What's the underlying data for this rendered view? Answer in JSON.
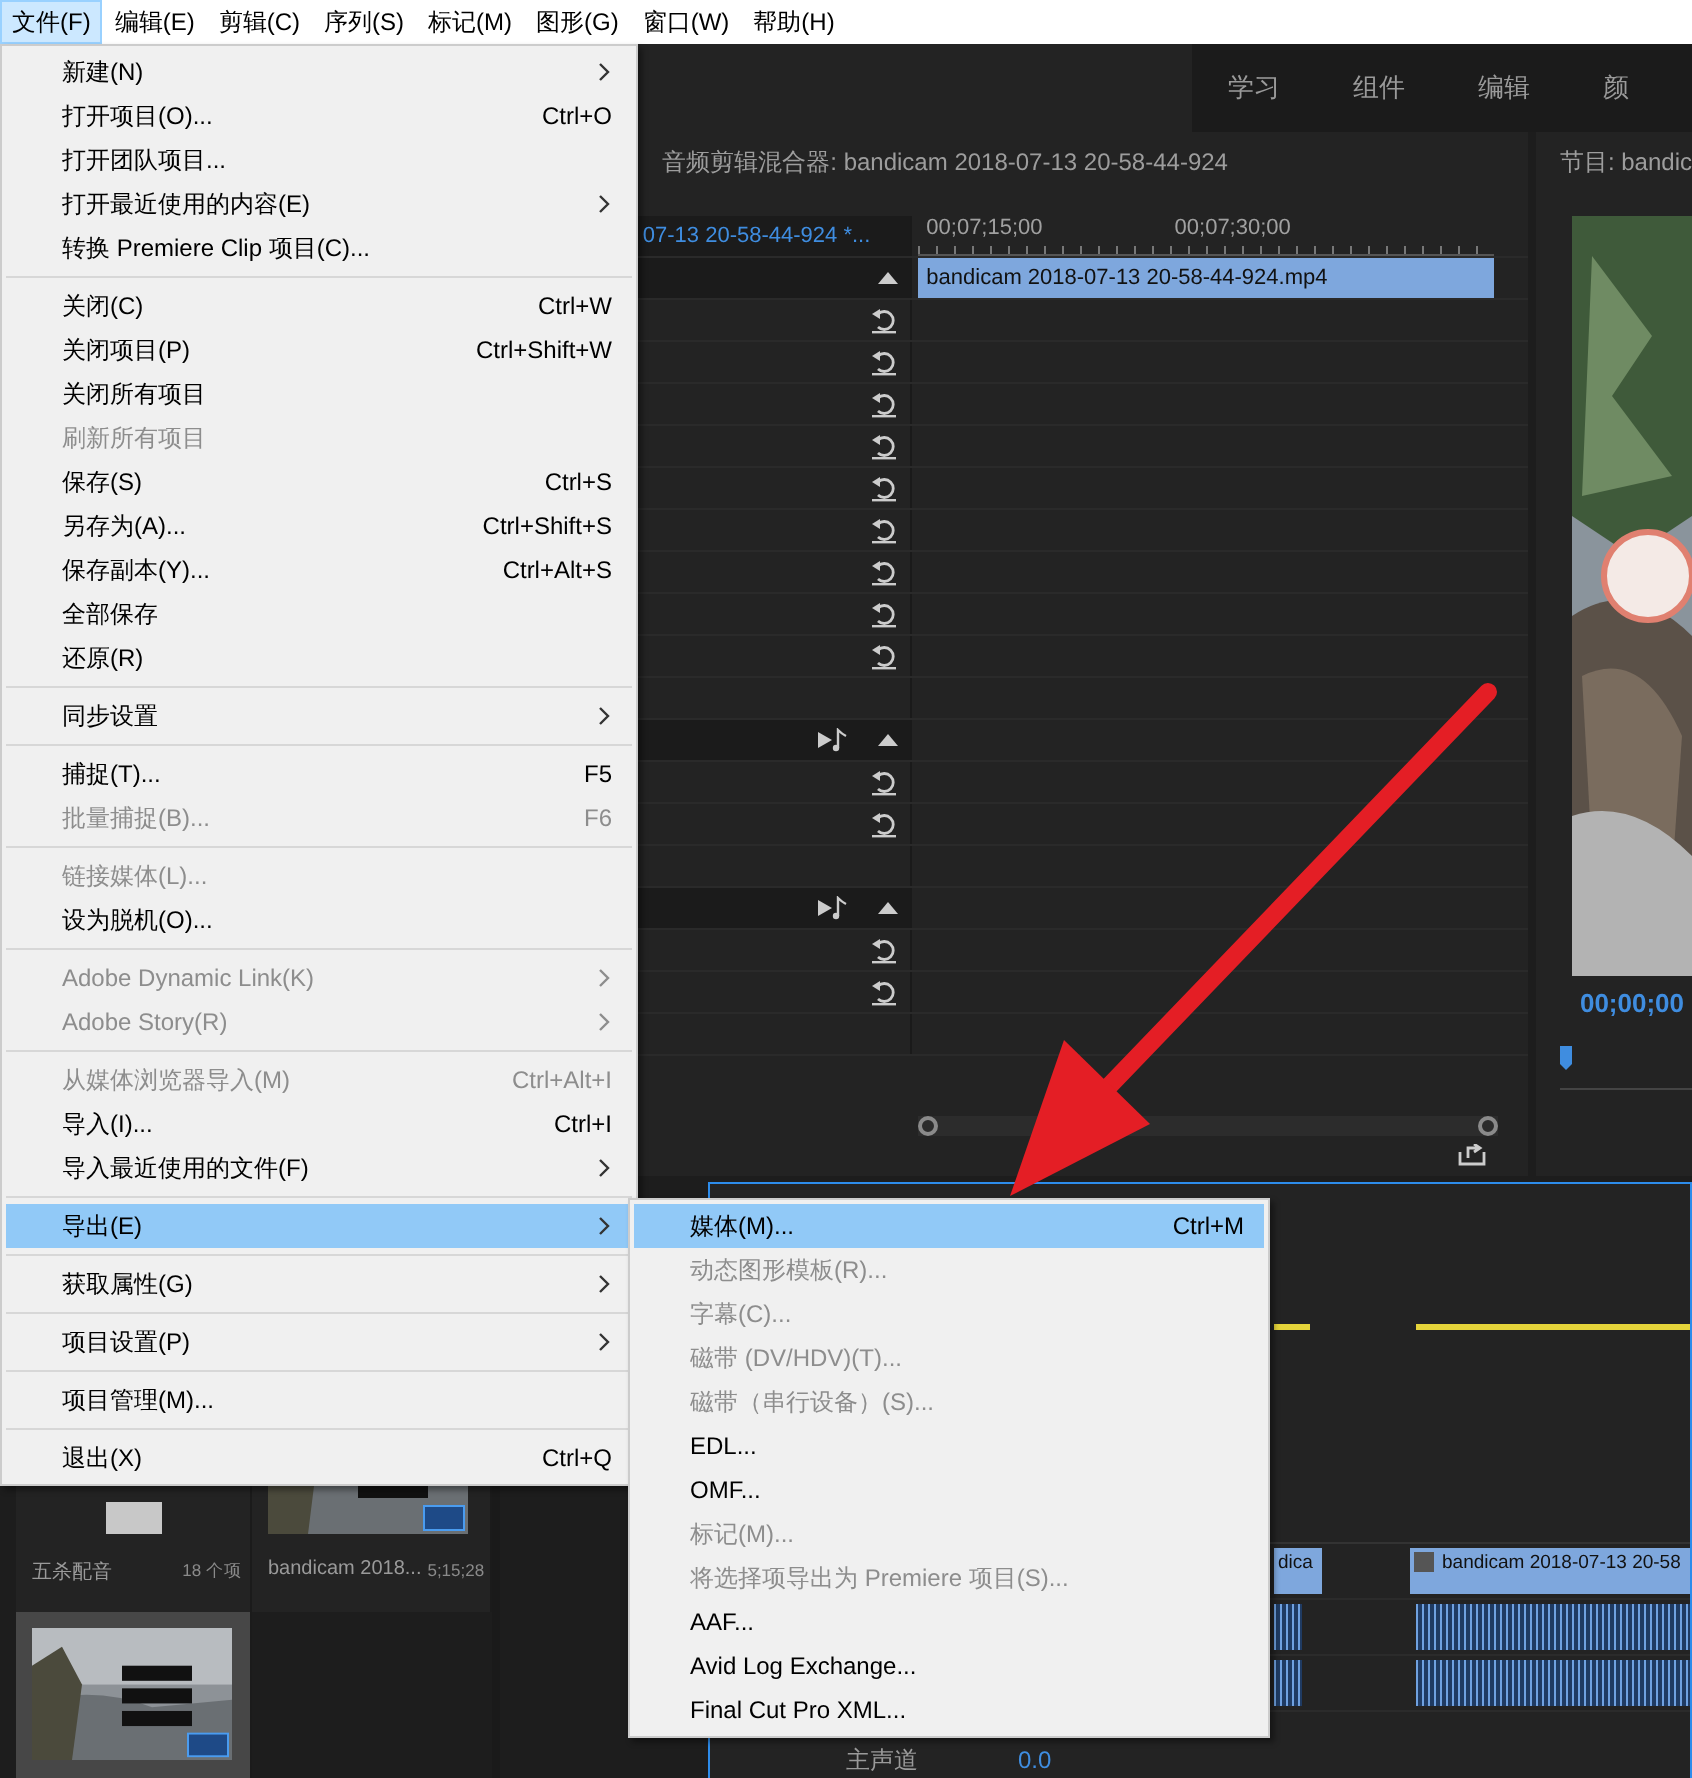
{
  "menubar": [
    {
      "label": "文件(F)",
      "selected": true
    },
    {
      "label": "编辑(E)",
      "selected": false
    },
    {
      "label": "剪辑(C)",
      "selected": false
    },
    {
      "label": "序列(S)",
      "selected": false
    },
    {
      "label": "标记(M)",
      "selected": false
    },
    {
      "label": "图形(G)",
      "selected": false
    },
    {
      "label": "窗口(W)",
      "selected": false
    },
    {
      "label": "帮助(H)",
      "selected": false
    }
  ],
  "workspaces": [
    {
      "label": "学习"
    },
    {
      "label": "组件"
    },
    {
      "label": "编辑"
    },
    {
      "label": "颜"
    }
  ],
  "audio_mixer": {
    "title": "音频剪辑混合器: bandicam 2018-07-13 20-58-44-924",
    "sequence_tab": "07-13 20-58-44-924 *...",
    "ruler": [
      "00;07;15;00",
      "00;07;30;00"
    ],
    "clip": "bandicam 2018-07-13 20-58-44-924.mp4",
    "tracks": [
      {
        "kind": "collapse"
      },
      {
        "kind": "reset"
      },
      {
        "kind": "reset"
      },
      {
        "kind": "reset"
      },
      {
        "kind": "reset"
      },
      {
        "kind": "reset"
      },
      {
        "kind": "reset"
      },
      {
        "kind": "reset"
      },
      {
        "kind": "reset"
      },
      {
        "kind": "reset"
      },
      {
        "kind": "empty"
      },
      {
        "kind": "audio"
      },
      {
        "kind": "reset"
      },
      {
        "kind": "reset"
      },
      {
        "kind": "empty"
      },
      {
        "kind": "audio"
      },
      {
        "kind": "reset"
      },
      {
        "kind": "reset"
      },
      {
        "kind": "empty"
      }
    ]
  },
  "program_monitor": {
    "title": "节目: bandic",
    "timecode": "00;00;00"
  },
  "project": {
    "items": [
      {
        "kind": "bin",
        "name": "五杀配音",
        "info": "18 个项"
      },
      {
        "kind": "clip",
        "name": "bandicam 2018...",
        "info": "5;15;28"
      },
      {
        "kind": "sequence",
        "selected": true
      }
    ]
  },
  "timeline": {
    "clips": [
      {
        "label": "dica"
      },
      {
        "label": "bandicam 2018-07-13 20-58"
      }
    ],
    "track_label": "主声道",
    "volume": "0.0"
  },
  "file_menu": [
    {
      "kind": "item",
      "label": "新建(N)",
      "submenu": true,
      "disabled": false,
      "selected": false
    },
    {
      "kind": "item",
      "label": "打开项目(O)...",
      "shortcut": "Ctrl+O",
      "submenu": false,
      "disabled": false,
      "selected": false
    },
    {
      "kind": "item",
      "label": "打开团队项目...",
      "submenu": false,
      "disabled": false,
      "selected": false
    },
    {
      "kind": "item",
      "label": "打开最近使用的内容(E)",
      "submenu": true,
      "disabled": false,
      "selected": false
    },
    {
      "kind": "item",
      "label": "转换 Premiere Clip 项目(C)...",
      "submenu": false,
      "disabled": false,
      "selected": false
    },
    {
      "kind": "separator"
    },
    {
      "kind": "item",
      "label": "关闭(C)",
      "shortcut": "Ctrl+W",
      "submenu": false,
      "disabled": false,
      "selected": false
    },
    {
      "kind": "item",
      "label": "关闭项目(P)",
      "shortcut": "Ctrl+Shift+W",
      "submenu": false,
      "disabled": false,
      "selected": false
    },
    {
      "kind": "item",
      "label": "关闭所有项目",
      "submenu": false,
      "disabled": false,
      "selected": false
    },
    {
      "kind": "item",
      "label": "刷新所有项目",
      "submenu": false,
      "disabled": true,
      "selected": false
    },
    {
      "kind": "item",
      "label": "保存(S)",
      "shortcut": "Ctrl+S",
      "submenu": false,
      "disabled": false,
      "selected": false
    },
    {
      "kind": "item",
      "label": "另存为(A)...",
      "shortcut": "Ctrl+Shift+S",
      "submenu": false,
      "disabled": false,
      "selected": false
    },
    {
      "kind": "item",
      "label": "保存副本(Y)...",
      "shortcut": "Ctrl+Alt+S",
      "submenu": false,
      "disabled": false,
      "selected": false
    },
    {
      "kind": "item",
      "label": "全部保存",
      "submenu": false,
      "disabled": false,
      "selected": false
    },
    {
      "kind": "item",
      "label": "还原(R)",
      "submenu": false,
      "disabled": false,
      "selected": false
    },
    {
      "kind": "separator"
    },
    {
      "kind": "item",
      "label": "同步设置",
      "submenu": true,
      "disabled": false,
      "selected": false
    },
    {
      "kind": "separator"
    },
    {
      "kind": "item",
      "label": "捕捉(T)...",
      "shortcut": "F5",
      "submenu": false,
      "disabled": false,
      "selected": false
    },
    {
      "kind": "item",
      "label": "批量捕捉(B)...",
      "shortcut": "F6",
      "submenu": false,
      "disabled": true,
      "selected": false
    },
    {
      "kind": "separator"
    },
    {
      "kind": "item",
      "label": "链接媒体(L)...",
      "submenu": false,
      "disabled": true,
      "selected": false
    },
    {
      "kind": "item",
      "label": "设为脱机(O)...",
      "submenu": false,
      "disabled": false,
      "selected": false
    },
    {
      "kind": "separator"
    },
    {
      "kind": "item",
      "label": "Adobe Dynamic Link(K)",
      "submenu": true,
      "disabled": true,
      "selected": false
    },
    {
      "kind": "item",
      "label": "Adobe Story(R)",
      "submenu": true,
      "disabled": true,
      "selected": false
    },
    {
      "kind": "separator"
    },
    {
      "kind": "item",
      "label": "从媒体浏览器导入(M)",
      "shortcut": "Ctrl+Alt+I",
      "submenu": false,
      "disabled": true,
      "selected": false
    },
    {
      "kind": "item",
      "label": "导入(I)...",
      "shortcut": "Ctrl+I",
      "submenu": false,
      "disabled": false,
      "selected": false
    },
    {
      "kind": "item",
      "label": "导入最近使用的文件(F)",
      "submenu": true,
      "disabled": false,
      "selected": false
    },
    {
      "kind": "separator"
    },
    {
      "kind": "item",
      "label": "导出(E)",
      "submenu": true,
      "disabled": false,
      "selected": true
    },
    {
      "kind": "separator"
    },
    {
      "kind": "item",
      "label": "获取属性(G)",
      "submenu": true,
      "disabled": false,
      "selected": false
    },
    {
      "kind": "separator"
    },
    {
      "kind": "item",
      "label": "项目设置(P)",
      "submenu": true,
      "disabled": false,
      "selected": false
    },
    {
      "kind": "separator"
    },
    {
      "kind": "item",
      "label": "项目管理(M)...",
      "submenu": false,
      "disabled": false,
      "selected": false
    },
    {
      "kind": "separator"
    },
    {
      "kind": "item",
      "label": "退出(X)",
      "shortcut": "Ctrl+Q",
      "submenu": false,
      "disabled": false,
      "selected": false
    }
  ],
  "export_menu": [
    {
      "kind": "item",
      "label": "媒体(M)...",
      "shortcut": "Ctrl+M",
      "submenu": false,
      "disabled": false,
      "selected": true
    },
    {
      "kind": "item",
      "label": "动态图形模板(R)...",
      "submenu": false,
      "disabled": true,
      "selected": false
    },
    {
      "kind": "item",
      "label": "字幕(C)...",
      "submenu": false,
      "disabled": true,
      "selected": false
    },
    {
      "kind": "item",
      "label": "磁带 (DV/HDV)(T)...",
      "submenu": false,
      "disabled": true,
      "selected": false
    },
    {
      "kind": "item",
      "label": "磁带（串行设备）(S)...",
      "submenu": false,
      "disabled": true,
      "selected": false
    },
    {
      "kind": "item",
      "label": "EDL...",
      "submenu": false,
      "disabled": false,
      "selected": false
    },
    {
      "kind": "item",
      "label": "OMF...",
      "submenu": false,
      "disabled": false,
      "selected": false
    },
    {
      "kind": "item",
      "label": "标记(M)...",
      "submenu": false,
      "disabled": true,
      "selected": false
    },
    {
      "kind": "item",
      "label": "将选择项导出为 Premiere 项目(S)...",
      "submenu": false,
      "disabled": true,
      "selected": false
    },
    {
      "kind": "item",
      "label": "AAF...",
      "submenu": false,
      "disabled": false,
      "selected": false
    },
    {
      "kind": "item",
      "label": "Avid Log Exchange...",
      "submenu": false,
      "disabled": false,
      "selected": false
    },
    {
      "kind": "item",
      "label": "Final Cut Pro XML...",
      "submenu": false,
      "disabled": false,
      "selected": false
    }
  ]
}
